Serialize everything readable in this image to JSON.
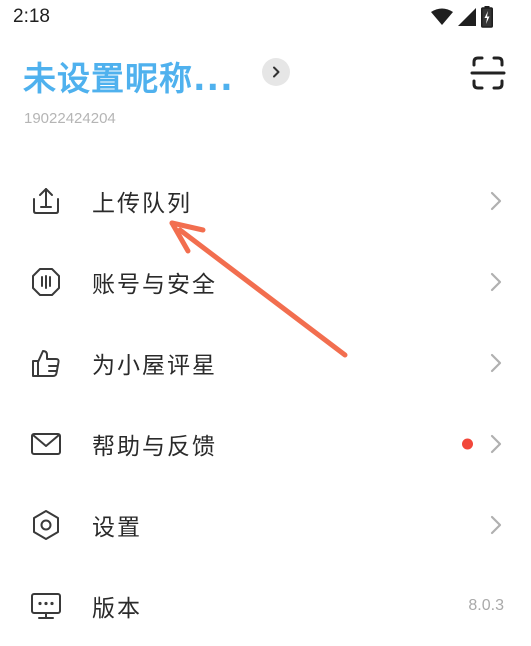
{
  "status_bar": {
    "time": "2:18",
    "icons": [
      "wifi-icon",
      "cellular-signal-icon",
      "battery-charging-icon"
    ]
  },
  "profile": {
    "nickname": "未设置昵称...",
    "phone": "19022424204"
  },
  "header_icons": {
    "expand": "chevron-right-icon",
    "scan": "scan-icon"
  },
  "menu": [
    {
      "label": "上传队列",
      "icon": "upload-icon"
    },
    {
      "label": "账号与安全",
      "icon": "shield-icon"
    },
    {
      "label": "为小屋评星",
      "icon": "thumbs-up-icon"
    },
    {
      "label": "帮助与反馈",
      "icon": "mail-icon",
      "badge_color": "#f2473a"
    },
    {
      "label": "设置",
      "icon": "hexagon-settings-icon"
    },
    {
      "label": "版本",
      "icon": "monitor-icon",
      "value": "8.0.3"
    }
  ],
  "colors": {
    "accent": "#4fb1ee",
    "annotation_arrow": "#f26e4f",
    "badge": "#f2473a"
  }
}
